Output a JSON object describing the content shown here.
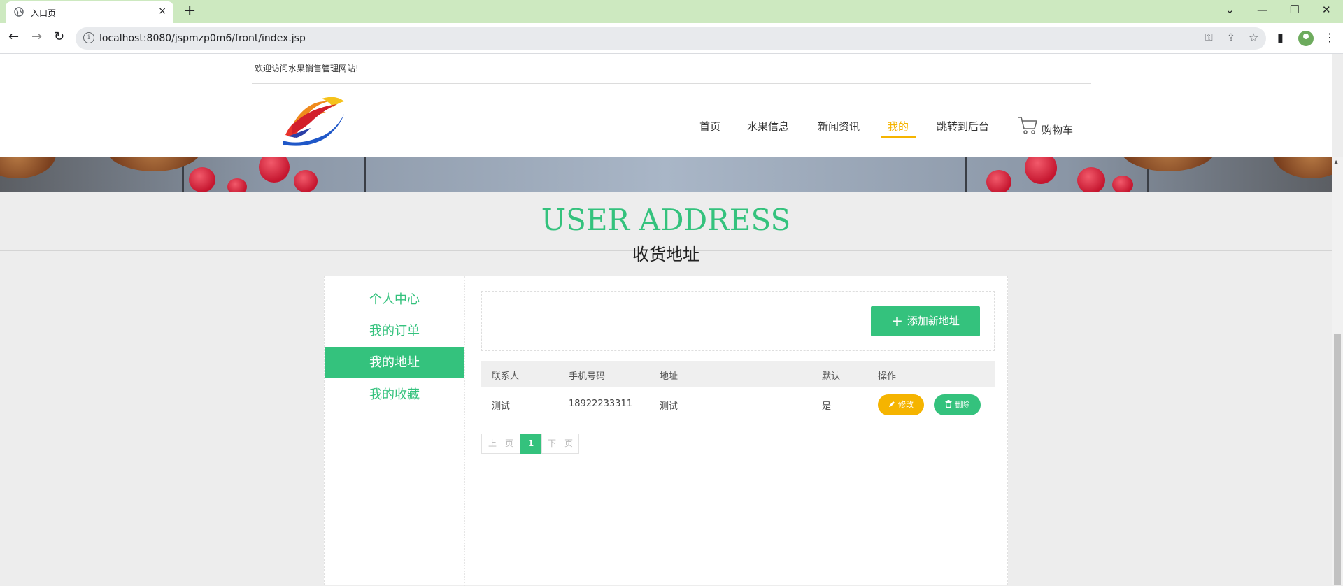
{
  "browser": {
    "tab_title": "入口页",
    "tab_close": "×",
    "new_tab": "+",
    "url": "localhost:8080/jspmzp0m6/front/index.jsp",
    "info_icon": "i",
    "window_controls": {
      "list": "⌄",
      "minimize": "—",
      "restore": "❐",
      "close": "✕"
    },
    "nav": {
      "back": "←",
      "forward": "→",
      "reload": "↻"
    },
    "omnibox_icons": {
      "key": "⚿",
      "share": "⇪",
      "star": "☆"
    },
    "toolbar_icons": {
      "sidepanel": "▮",
      "menu": "⋮"
    }
  },
  "header": {
    "welcome": "欢迎访问水果销售管理网站!",
    "nav": [
      {
        "label": "首页"
      },
      {
        "label": "水果信息"
      },
      {
        "label": "新闻资讯"
      },
      {
        "label": "我的"
      },
      {
        "label": "跳转到后台"
      }
    ],
    "active_nav": "我的",
    "cart_label": "购物车"
  },
  "section": {
    "title_en": "USER ADDRESS",
    "title_cn": "收货地址"
  },
  "sidebar": {
    "items": [
      {
        "label": "个人中心"
      },
      {
        "label": "我的订单"
      },
      {
        "label": "我的地址"
      },
      {
        "label": "我的收藏"
      }
    ],
    "active": "我的地址"
  },
  "toolbox": {
    "add_plus": "+",
    "add_label": "添加新地址"
  },
  "table": {
    "headers": [
      "联系人",
      "手机号码",
      "地址",
      "默认",
      "操作"
    ],
    "rows": [
      {
        "contact": "测试",
        "phone": "18922233311",
        "address": "测试",
        "default": "是",
        "edit": "修改",
        "delete": "删除"
      }
    ]
  },
  "pagination": {
    "prev": "上一页",
    "current": "1",
    "next": "下一页"
  },
  "colors": {
    "accent": "#34c27d",
    "nav_active": "#f5b400",
    "edit_button": "#f5b400",
    "delete_button": "#34c27d"
  }
}
